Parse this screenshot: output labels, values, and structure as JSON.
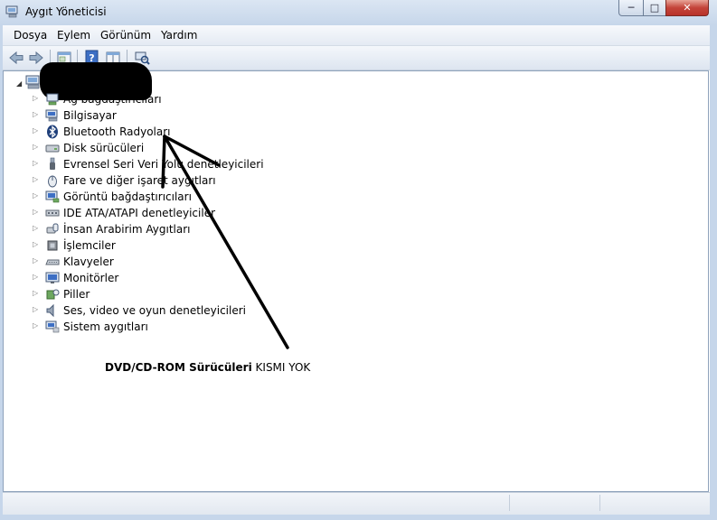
{
  "window": {
    "title": "Aygıt Yöneticisi",
    "minimize_glyph": "─",
    "maximize_glyph": "□",
    "close_glyph": "✕",
    "accent_color": "#c4443a"
  },
  "menu": {
    "items": [
      "Dosya",
      "Eylem",
      "Görünüm",
      "Yardım"
    ]
  },
  "toolbar": {
    "icons": [
      "back-arrow-icon",
      "forward-arrow-icon",
      "properties-icon",
      "help-icon",
      "show-hide-pane-icon",
      "scan-hardware-icon"
    ]
  },
  "tree": {
    "root_icon": "computer-icon",
    "items": [
      {
        "label": "Ağ bağdaştırıcıları",
        "icon": "network-adapter-icon"
      },
      {
        "label": "Bilgisayar",
        "icon": "computer-icon"
      },
      {
        "label": "Bluetooth Radyoları",
        "icon": "bluetooth-icon"
      },
      {
        "label": "Disk sürücüleri",
        "icon": "disk-drive-icon"
      },
      {
        "label": "Evrensel Seri Veri Yolu denetleyicileri",
        "icon": "usb-icon"
      },
      {
        "label": "Fare ve diğer işaret aygıtları",
        "icon": "mouse-icon"
      },
      {
        "label": "Görüntü bağdaştırıcıları",
        "icon": "display-adapter-icon"
      },
      {
        "label": "IDE ATA/ATAPI denetleyiciler",
        "icon": "ide-controller-icon"
      },
      {
        "label": "İnsan Arabirim Aygıtları",
        "icon": "hid-icon"
      },
      {
        "label": "İşlemciler",
        "icon": "processor-icon"
      },
      {
        "label": "Klavyeler",
        "icon": "keyboard-icon"
      },
      {
        "label": "Monitörler",
        "icon": "monitor-icon"
      },
      {
        "label": "Piller",
        "icon": "battery-icon"
      },
      {
        "label": "Ses, video ve oyun denetleyicileri",
        "icon": "sound-icon"
      },
      {
        "label": "Sistem aygıtları",
        "icon": "system-device-icon"
      }
    ]
  },
  "annotation": {
    "bold_part": "DVD/CD-ROM Sürücüleri",
    "normal_part": " KISMI YOK"
  }
}
